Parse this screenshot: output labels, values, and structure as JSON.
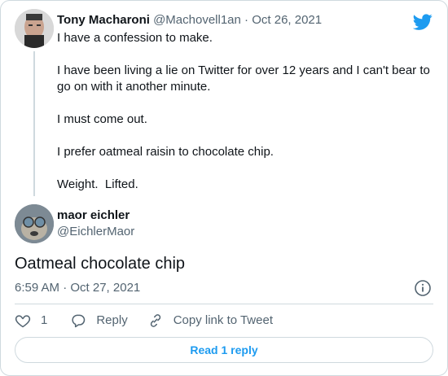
{
  "parent_tweet": {
    "author_name": "Tony Macharoni",
    "handle": "@Machovell1an",
    "separator": " · ",
    "date": "Oct 26, 2021",
    "paragraphs": [
      "I have a confession to make.",
      "I have been living a lie on Twitter for over 12 years and I can't bear to go on with it another minute.",
      "I must come out.",
      "I prefer oatmeal raisin to chocolate chip.",
      "Weight.  Lifted."
    ]
  },
  "reply_tweet": {
    "author_name": "maor eichler",
    "handle": "@EichlerMaor",
    "text": "Oatmeal chocolate chip",
    "timestamp": "6:59 AM · Oct 27, 2021"
  },
  "actions": {
    "like_count": "1",
    "reply_label": "Reply",
    "copy_link_label": "Copy link to Tweet"
  },
  "read_replies_label": "Read 1 reply",
  "icons": {
    "brand": "twitter-bird-icon",
    "info": "info-icon",
    "like": "heart-icon",
    "reply": "speech-bubble-icon",
    "copy_link": "link-icon"
  },
  "colors": {
    "brand_blue": "#1d9bf0",
    "secondary_text": "#536471",
    "border": "#cfd9de"
  }
}
